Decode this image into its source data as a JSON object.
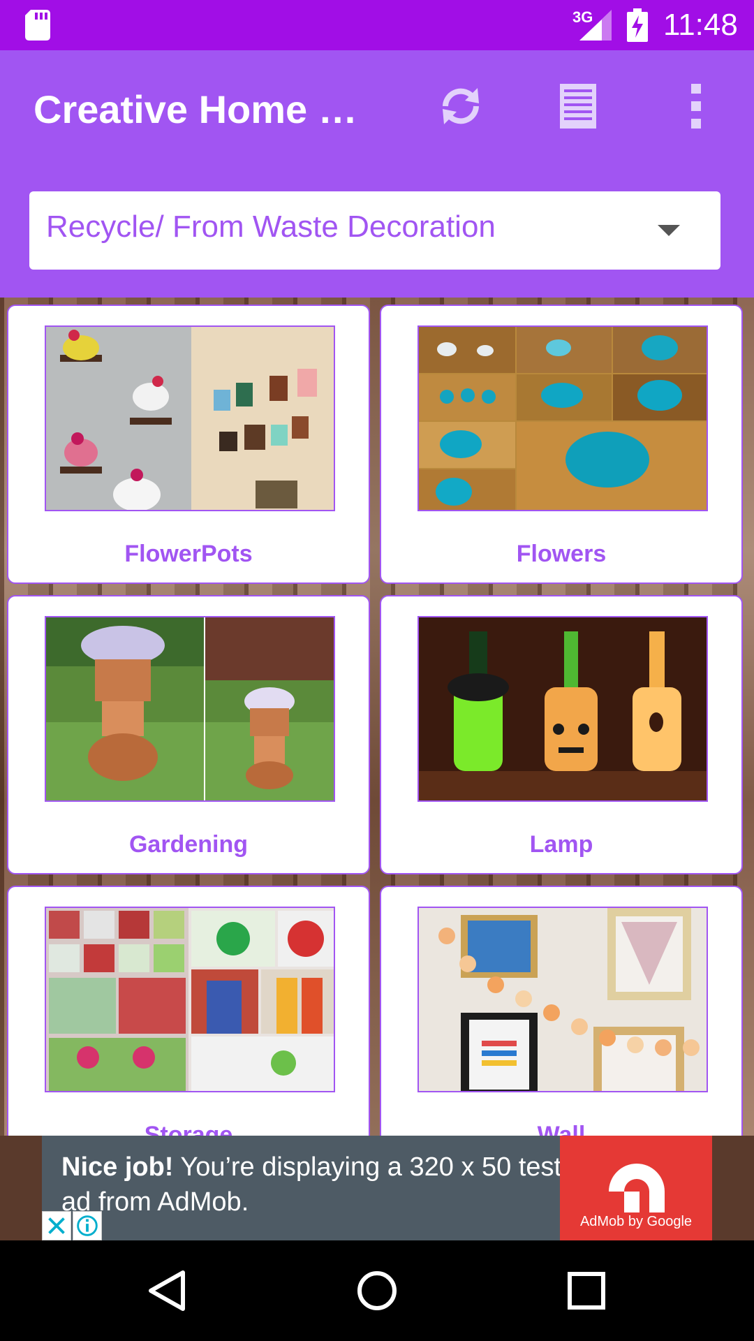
{
  "status_bar": {
    "network": "3G",
    "time": "11:48"
  },
  "app_bar": {
    "title": "Creative Home D…",
    "icons": [
      "refresh-icon",
      "list-icon",
      "more-vert-icon"
    ]
  },
  "category_dropdown": {
    "selected": "Recycle/ From Waste Decoration"
  },
  "grid": {
    "items": [
      {
        "label": "FlowerPots"
      },
      {
        "label": "Flowers"
      },
      {
        "label": "Gardening"
      },
      {
        "label": "Lamp"
      },
      {
        "label": "Storage"
      },
      {
        "label": "Wall"
      }
    ]
  },
  "ad": {
    "bold": "Nice job!",
    "text": " You’re displaying a 320 x 50 test ad from AdMob.",
    "logo_label": "AdMob by Google"
  },
  "colors": {
    "status_bar": "#a10ee6",
    "app_bar": "#a155f2",
    "accent": "#a155f2",
    "ad_red": "#e53935"
  }
}
